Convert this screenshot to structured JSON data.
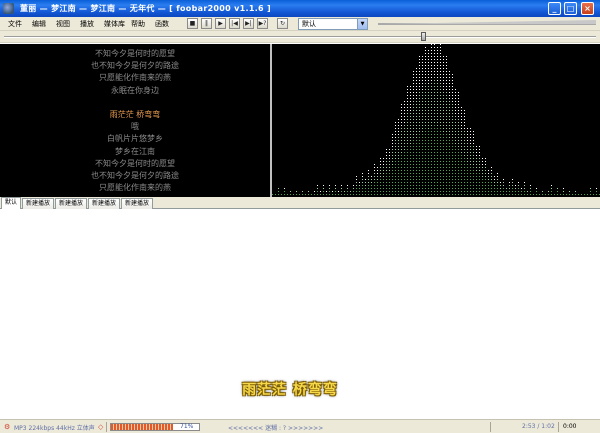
{
  "window": {
    "title": "董丽 — 梦江南 — 梦江南 — 无年代 — [ foobar2000 v1.1.6 ]"
  },
  "menu": {
    "items": [
      "文件",
      "编辑",
      "视图",
      "播放",
      "媒体库",
      "帮助",
      "函数"
    ]
  },
  "toolbar": {
    "buttons": [
      "stop-icon",
      "pause-icon",
      "play-icon",
      "prev-icon",
      "next-icon",
      "random-icon",
      "order-icon"
    ],
    "playback_order": "默认"
  },
  "seek": {
    "position_percent": 71
  },
  "lyrics": {
    "lines": [
      {
        "text": "不知今夕是何时的愿望",
        "highlight": false
      },
      {
        "text": "也不知今夕是何夕的路途",
        "highlight": false
      },
      {
        "text": "只愿能化作南来的燕",
        "highlight": false
      },
      {
        "text": "永眠在你身边",
        "highlight": false
      },
      {
        "text": "",
        "highlight": false
      },
      {
        "text": "雨茫茫 桥弯弯",
        "highlight": true
      },
      {
        "text": "哦",
        "highlight": false
      },
      {
        "text": "白帆片片悠梦乡",
        "highlight": false
      },
      {
        "text": "梦乡在江南",
        "highlight": false
      },
      {
        "text": "不知今夕是何时的愿望",
        "highlight": false
      },
      {
        "text": "也不知今夕是何夕的路途",
        "highlight": false
      },
      {
        "text": "只愿能化作南来的燕",
        "highlight": false
      }
    ]
  },
  "tabs": [
    {
      "label": "默认",
      "active": true
    },
    {
      "label": "新建播放",
      "active": false
    },
    {
      "label": "新建播放",
      "active": false
    },
    {
      "label": "新建播放",
      "active": false
    },
    {
      "label": "新建播放",
      "active": false
    }
  ],
  "desktop_lyric": "雨茫茫 桥弯弯",
  "status": {
    "format": "MP3 224kbps 44kHz 立体声",
    "progress_percent": 71,
    "progress_label": "71%",
    "lyric_state": "<<<<<<< 迷糊 : ? >>>>>>>",
    "time": "2:53 / 1:02",
    "elapsed": "0:00"
  },
  "colors": {
    "titlebar": "#1458d6",
    "lyric_text": "#8a8a8a",
    "lyric_highlight": "#f0a050",
    "spectrum_dots": "#4aa84a",
    "spectrum_peak": "#ffffff",
    "desktop_lyric": "#f6d84a"
  }
}
